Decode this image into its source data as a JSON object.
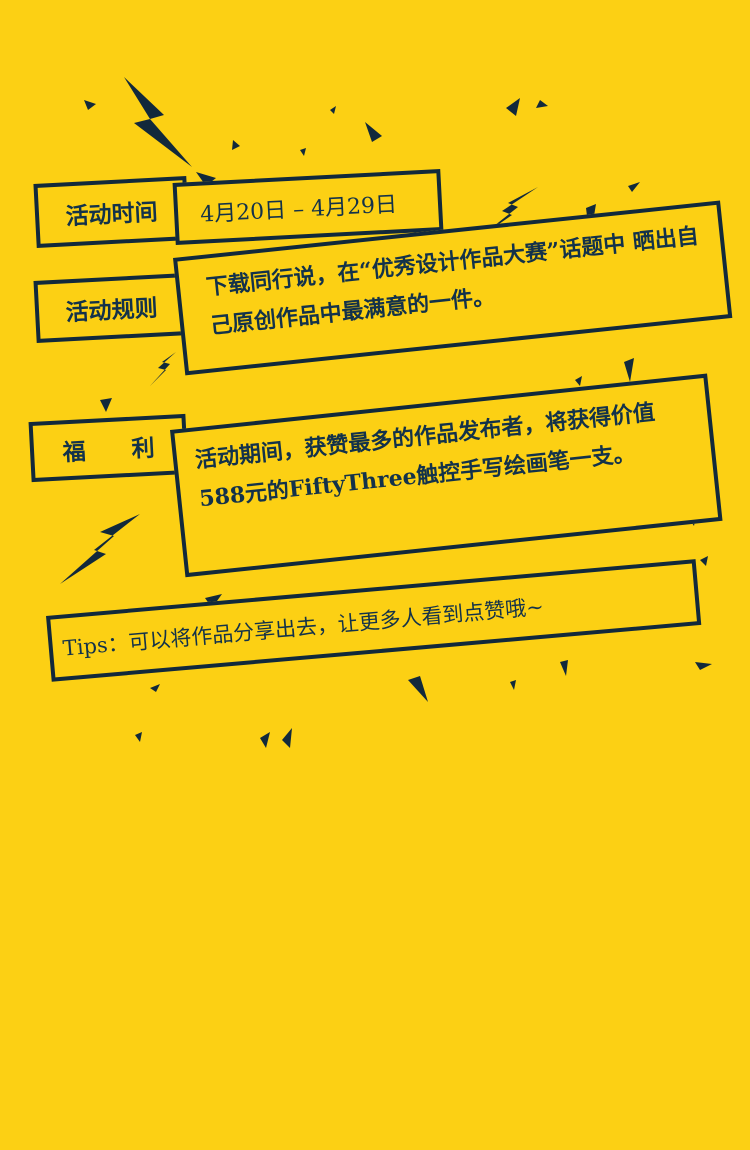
{
  "activity": {
    "time_label": "活动时间",
    "time_value": "4月20日 – 4月29日",
    "rules_label": "活动规则",
    "rules_text": "下载同行说，在“优秀设计作品大赛”话题中 晒出自己原创作品中最满意的一件。",
    "benefit_label": "福　　利",
    "benefit_text": "活动期间，获赞最多的作品发布者，将获得价值588元的FiftyThree触控手写绘画笔一支。",
    "tips_text": "Tips：可以将作品分享出去，让更多人看到点赞哦~"
  },
  "colors": {
    "background": "#fcd014",
    "ink": "#12293b"
  },
  "icons": [
    "lightning-bolt-icon",
    "lightning-bolt-icon",
    "lightning-bolt-icon",
    "lightning-bolt-icon"
  ]
}
